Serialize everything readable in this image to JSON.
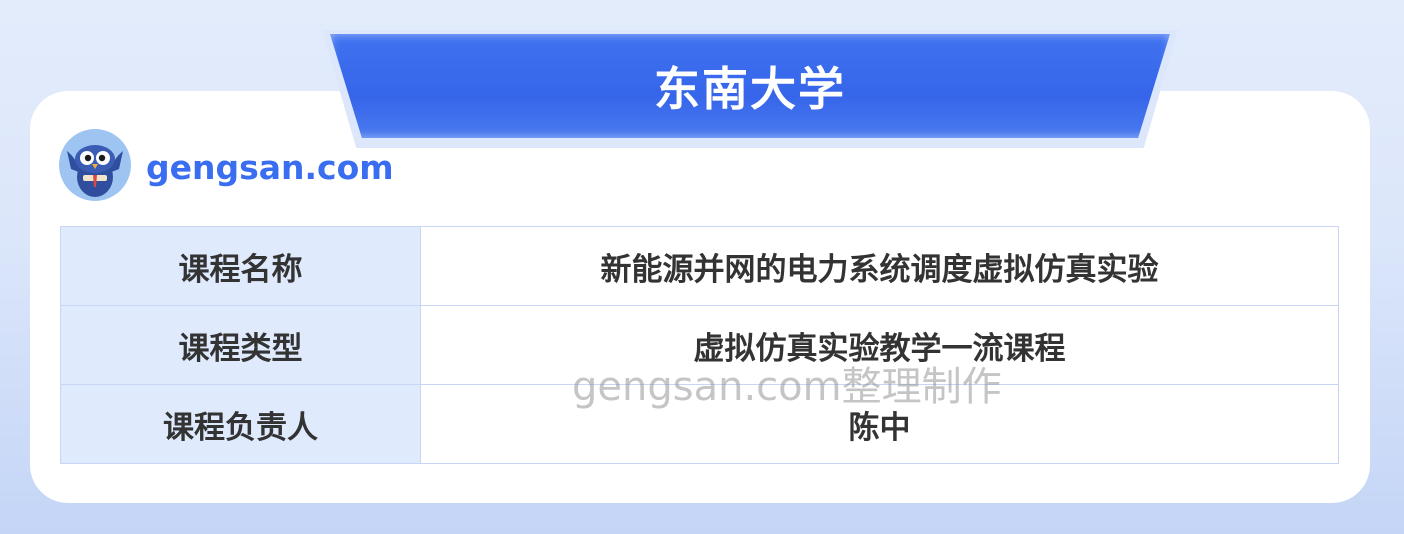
{
  "header": {
    "title": "东南大学"
  },
  "brand": {
    "site": "gengsan.com",
    "logo_icon": "owl-mascot-icon"
  },
  "table": {
    "rows": [
      {
        "label": "课程名称",
        "value": "新能源并网的电力系统调度虚拟仿真实验"
      },
      {
        "label": "课程类型",
        "value": "虚拟仿真实验教学一流课程"
      },
      {
        "label": "课程负责人",
        "value": "陈中"
      }
    ]
  },
  "watermark": {
    "text": "gengsan.com整理制作"
  },
  "colors": {
    "accent": "#3a6ef0",
    "label_bg": "#dfeafd",
    "border": "#c6d6f4"
  }
}
